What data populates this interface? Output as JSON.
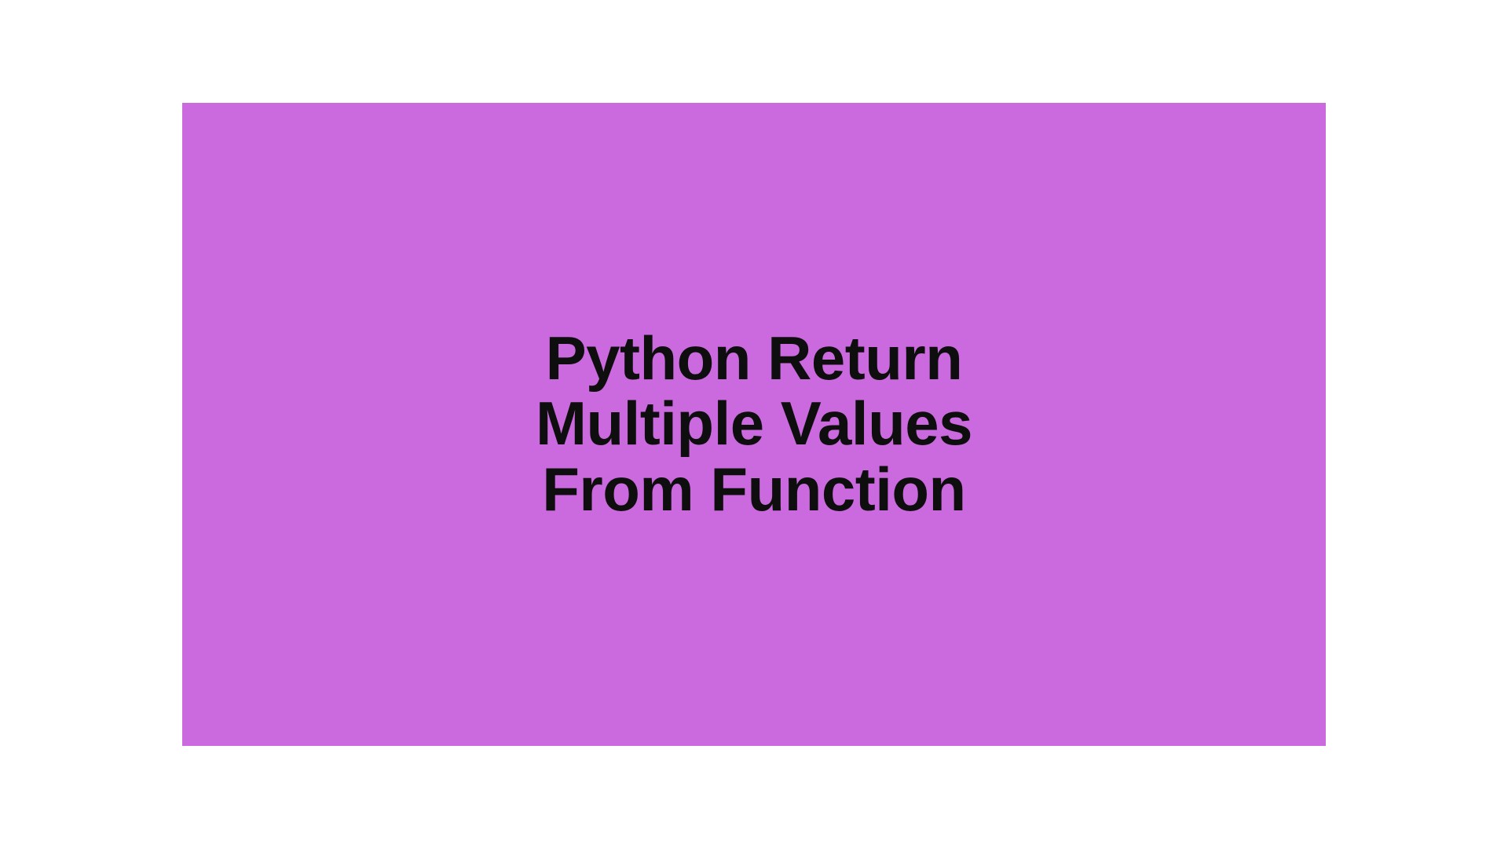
{
  "heading": {
    "line1": "Python Return",
    "line2": "Multiple Values",
    "line3": "From Function"
  },
  "colors": {
    "background": "#cb69de",
    "text": "#0e0e0e"
  }
}
